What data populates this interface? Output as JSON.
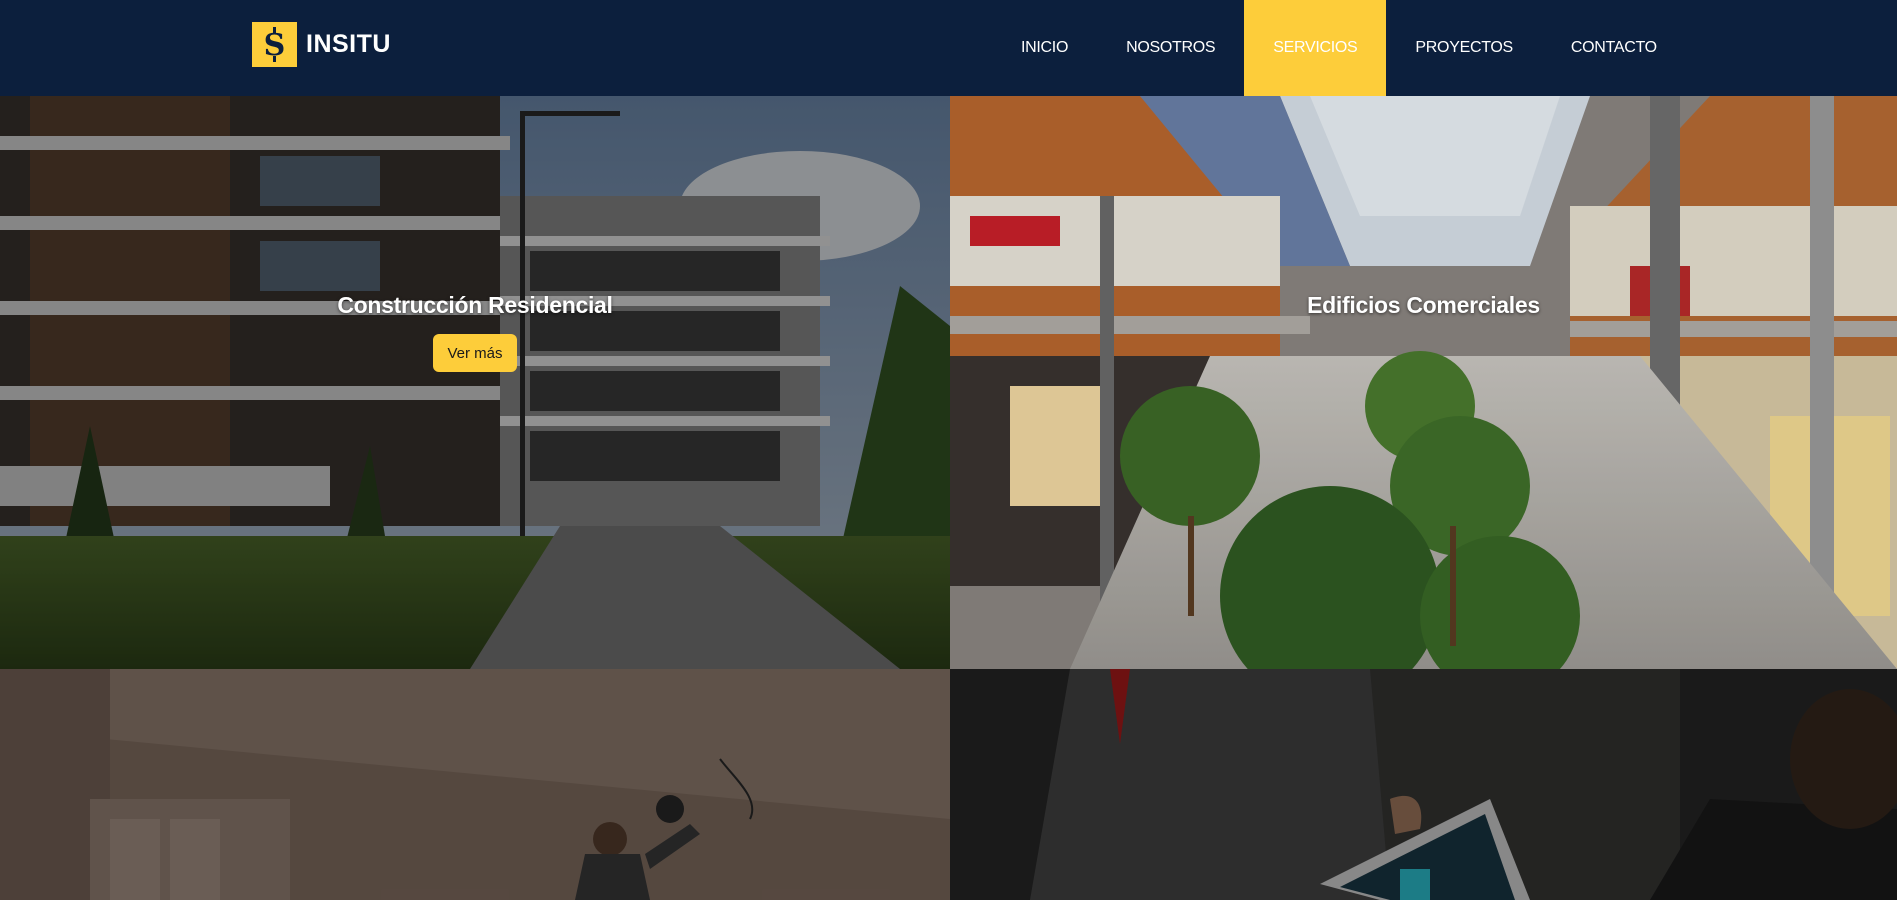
{
  "brand": {
    "logo_icon": "s-logo-icon",
    "logo_letter": "S",
    "name": "INSITU"
  },
  "nav": {
    "items": [
      {
        "label": "INICIO",
        "active": false
      },
      {
        "label": "NOSOTROS",
        "active": false
      },
      {
        "label": "SERVICIOS",
        "active": true
      },
      {
        "label": "PROYECTOS",
        "active": false
      },
      {
        "label": "CONTACTO",
        "active": false
      }
    ]
  },
  "services": [
    {
      "title": "Construcción Residencial",
      "button": "Ver más",
      "image": "residential-building-photo"
    },
    {
      "title": "Edificios Comerciales",
      "image": "shopping-mall-photo"
    },
    {
      "title": "",
      "image": "interior-electrical-work-photo"
    },
    {
      "title": "",
      "image": "team-meeting-tablet-photo"
    }
  ],
  "colors": {
    "header_bg": "#0c1f3d",
    "accent": "#fdcd3a",
    "text_light": "#ffffff"
  }
}
